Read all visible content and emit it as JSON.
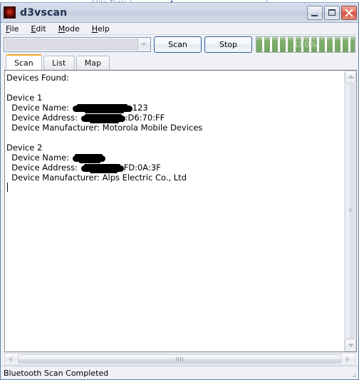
{
  "background_window": {
    "title_fragment": "lile  Tools  |"
  },
  "window": {
    "title": "d3vscan",
    "icon": "app-icon",
    "controls": {
      "minimize": "Minimize",
      "maximize": "Maximize",
      "close": "Close"
    }
  },
  "menu": [
    {
      "label": "File",
      "accel": "F"
    },
    {
      "label": "Edit",
      "accel": "E"
    },
    {
      "label": "Mode",
      "accel": "M"
    },
    {
      "label": "Help",
      "accel": "H"
    }
  ],
  "toolbar": {
    "device_combo": {
      "value": "",
      "placeholder": ""
    },
    "scan_label": "Scan",
    "stop_label": "Stop",
    "progress": {
      "percent": 100,
      "label": "100%",
      "fill_color": "#7aab69"
    }
  },
  "tabs": [
    {
      "label": "Scan",
      "active": true
    },
    {
      "label": "List",
      "active": false
    },
    {
      "label": "Map",
      "active": false
    }
  ],
  "output": {
    "heading": "Devices Found:",
    "lines": [
      {
        "kind": "text",
        "text": "Devices Found:"
      },
      {
        "kind": "blank",
        "text": ""
      },
      {
        "kind": "text",
        "text": "Device 1"
      },
      {
        "kind": "redacted",
        "prefix": "  Device Name: ",
        "redact_width": 84,
        "suffix": "123"
      },
      {
        "kind": "redacted",
        "prefix": "  Device Address: ",
        "redact_width": 62,
        "suffix": ":D6:70:FF"
      },
      {
        "kind": "text",
        "text": "  Device Manufacturer: Motorola Mobile Devices"
      },
      {
        "kind": "blank",
        "text": ""
      },
      {
        "kind": "text",
        "text": "Device 2"
      },
      {
        "kind": "redacted",
        "prefix": "  Device Name: ",
        "redact_width": 46,
        "suffix": ""
      },
      {
        "kind": "redacted",
        "prefix": "  Device Address: ",
        "redact_width": 60,
        "suffix": "FD:0A:3F"
      },
      {
        "kind": "text",
        "text": "  Device Manufacturer: Alps Electric Co., Ltd"
      }
    ]
  },
  "scrollbars": {
    "vertical": {
      "up": "Scroll up",
      "down": "Scroll down",
      "thumb": "Vertical scroll thumb"
    },
    "horizontal": {
      "left": "Scroll left",
      "right": "Scroll right",
      "thumb": "Horizontal scroll thumb"
    }
  },
  "status": {
    "text": "Bluetooth Scan Completed"
  }
}
